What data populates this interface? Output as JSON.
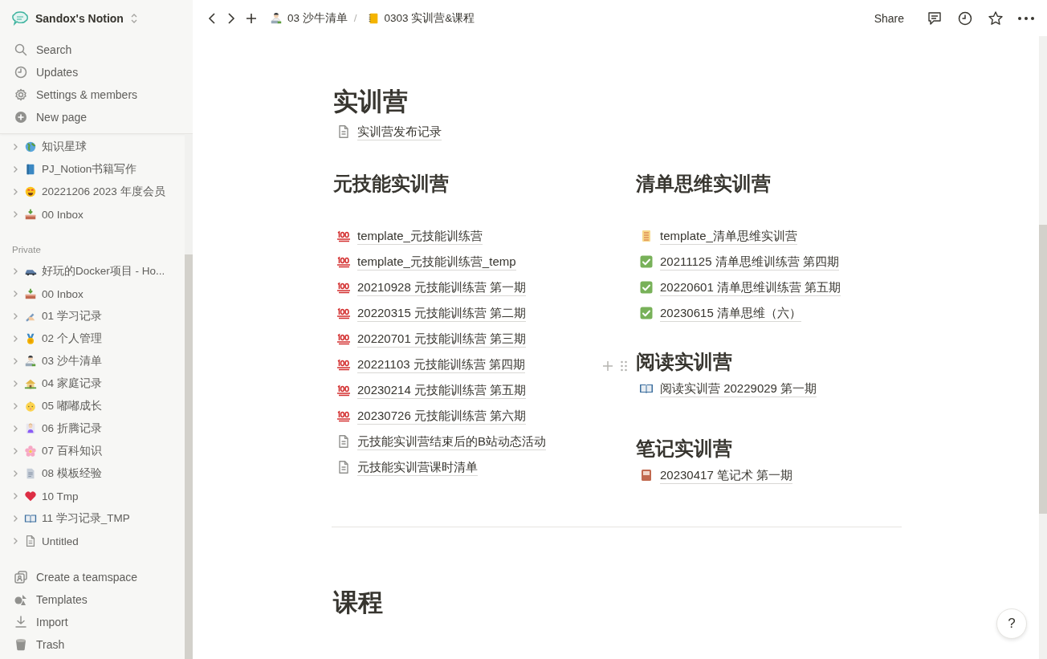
{
  "sidebar": {
    "workspace": "Sandox's Notion",
    "menu": [
      {
        "label": "Search",
        "kind": "search"
      },
      {
        "label": "Updates",
        "kind": "clock"
      },
      {
        "label": "Settings & members",
        "kind": "gear"
      },
      {
        "label": "New page",
        "kind": "plus"
      }
    ],
    "pages": [
      {
        "label": "知识星球",
        "kind": "globe",
        "expanded": false
      },
      {
        "label": "PJ_Notion书籍写作",
        "kind": "blue-book",
        "expanded": false
      },
      {
        "label": "20221206 2023 年度会员",
        "kind": "star-face",
        "expanded": false
      },
      {
        "label": "00 Inbox",
        "kind": "inbox",
        "expanded": false
      }
    ],
    "section_label": "Private",
    "private_pages": [
      {
        "label": "好玩的Docker项目 - Ho...",
        "kind": "car",
        "expanded": false
      },
      {
        "label": "00 Inbox",
        "kind": "inbox",
        "expanded": false
      },
      {
        "label": "01 学习记录",
        "kind": "writing-hand",
        "expanded": false
      },
      {
        "label": "02 个人管理",
        "kind": "medal",
        "expanded": false
      },
      {
        "label": "03 沙牛清单",
        "kind": "person-laptop",
        "expanded": false
      },
      {
        "label": "04 家庭记录",
        "kind": "house",
        "expanded": false
      },
      {
        "label": "05 嘟嘟成长",
        "kind": "baby",
        "expanded": false
      },
      {
        "label": "06 折腾记录",
        "kind": "person",
        "expanded": false
      },
      {
        "label": "07 百科知识",
        "kind": "blossom",
        "expanded": false
      },
      {
        "label": "08 模板经验",
        "kind": "doc-lines",
        "expanded": false
      },
      {
        "label": "10 Tmp",
        "kind": "heart",
        "expanded": false
      },
      {
        "label": "11 学习记录_TMP",
        "kind": "open-book",
        "expanded": false
      },
      {
        "label": "Untitled",
        "kind": "page",
        "expanded": false
      }
    ],
    "footer": [
      {
        "label": "Create a teamspace",
        "kind": "team"
      },
      {
        "label": "Templates",
        "kind": "shapes"
      },
      {
        "label": "Import",
        "kind": "download"
      },
      {
        "label": "Trash",
        "kind": "trash"
      }
    ]
  },
  "topbar": {
    "breadcrumbs": [
      {
        "label": "03 沙牛清单",
        "kind": "person-laptop"
      },
      {
        "label": "0303 实训营&课程",
        "kind": "notebook"
      }
    ],
    "separator": "/",
    "share": "Share"
  },
  "page": {
    "title": "实训营",
    "links": [
      {
        "label": "实训营发布记录",
        "kind": "page"
      }
    ],
    "columns": [
      {
        "sections": [
          {
            "heading": "元技能实训营",
            "links": [
              {
                "label": "template_元技能训练营",
                "kind": "hundred"
              },
              {
                "label": "template_元技能训练营_temp",
                "kind": "hundred"
              },
              {
                "label": "20210928 元技能训练营 第一期",
                "kind": "hundred"
              },
              {
                "label": "20220315 元技能训练营 第二期",
                "kind": "hundred"
              },
              {
                "label": "20220701 元技能训练营 第三期",
                "kind": "hundred"
              },
              {
                "label": "20221103 元技能训练营 第四期",
                "kind": "hundred"
              },
              {
                "label": "20230214 元技能训练营 第五期",
                "kind": "hundred"
              },
              {
                "label": "20230726 元技能训练营 第六期",
                "kind": "hundred"
              },
              {
                "label": "元技能实训营结束后的B站动态活动",
                "kind": "page"
              },
              {
                "label": "元技能实训营课时清单",
                "kind": "page"
              }
            ]
          }
        ]
      },
      {
        "sections": [
          {
            "heading": "清单思维实训营",
            "links": [
              {
                "label": "template_清单思维实训营",
                "kind": "scroll"
              },
              {
                "label": "20211125 清单思维训练营 第四期",
                "kind": "check"
              },
              {
                "label": "20220601 清单思维训练营 第五期",
                "kind": "check"
              },
              {
                "label": "20230615 清单思维（六）",
                "kind": "check"
              }
            ]
          },
          {
            "heading": "阅读实训营",
            "links": [
              {
                "label": "阅读实训营 20229029 第一期",
                "kind": "open-book"
              }
            ]
          },
          {
            "heading": "笔记实训营",
            "links": [
              {
                "label": "20230417 笔记术 第一期",
                "kind": "red-book"
              }
            ]
          }
        ]
      }
    ],
    "next_heading": "课程"
  },
  "help": "?"
}
